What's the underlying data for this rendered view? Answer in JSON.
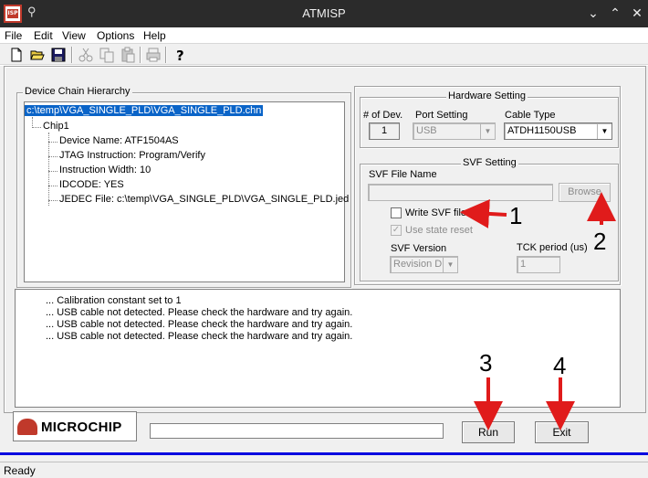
{
  "window": {
    "title": "ATMISP",
    "app_icon_text": "ISP"
  },
  "menu": [
    "File",
    "Edit",
    "View",
    "Options",
    "Help"
  ],
  "toolbar": {
    "icons": [
      "new-file-icon",
      "open-folder-icon",
      "save-icon",
      "cut-icon",
      "copy-icon",
      "paste-icon",
      "print-icon",
      "help-icon"
    ]
  },
  "device_chain": {
    "title": "Device Chain Hierarchy",
    "root": "c:\\temp\\VGA_SINGLE_PLD\\VGA_SINGLE_PLD.chn",
    "chip": "Chip1",
    "details": [
      "Device Name: ATF1504AS",
      "JTAG Instruction: Program/Verify",
      "Instruction Width: 10",
      "IDCODE: YES",
      "JEDEC File: c:\\temp\\VGA_SINGLE_PLD\\VGA_SINGLE_PLD.jed"
    ]
  },
  "hardware": {
    "title": "Hardware Setting",
    "num_dev_label": "# of Dev.",
    "num_dev_value": "1",
    "port_label": "Port Setting",
    "port_value": "USB",
    "cable_label": "Cable Type",
    "cable_value": "ATDH1150USB"
  },
  "svf": {
    "title": "SVF Setting",
    "file_name_label": "SVF File Name",
    "file_name_value": "",
    "browse_label": "Browse",
    "write_svf_label": "Write SVF file",
    "use_state_reset_label": "Use state reset",
    "version_label": "SVF Version",
    "version_value": "Revision D",
    "tck_label": "TCK period (us)",
    "tck_value": "1"
  },
  "log": [
    "...  Calibration constant set to 1",
    "...  USB cable not detected. Please check the hardware and try again.",
    "...  USB cable not detected. Please check the hardware and try again.",
    "...  USB cable not detected. Please check the hardware and try again."
  ],
  "logo_text": "MICROCHIP",
  "buttons": {
    "run": "Run",
    "exit": "Exit"
  },
  "annotations": [
    "1",
    "2",
    "3",
    "4"
  ],
  "status": "Ready",
  "colors": {
    "selection": "#0a64c8",
    "arrow": "#e01b1b",
    "accent_bar": "#0000e0"
  }
}
